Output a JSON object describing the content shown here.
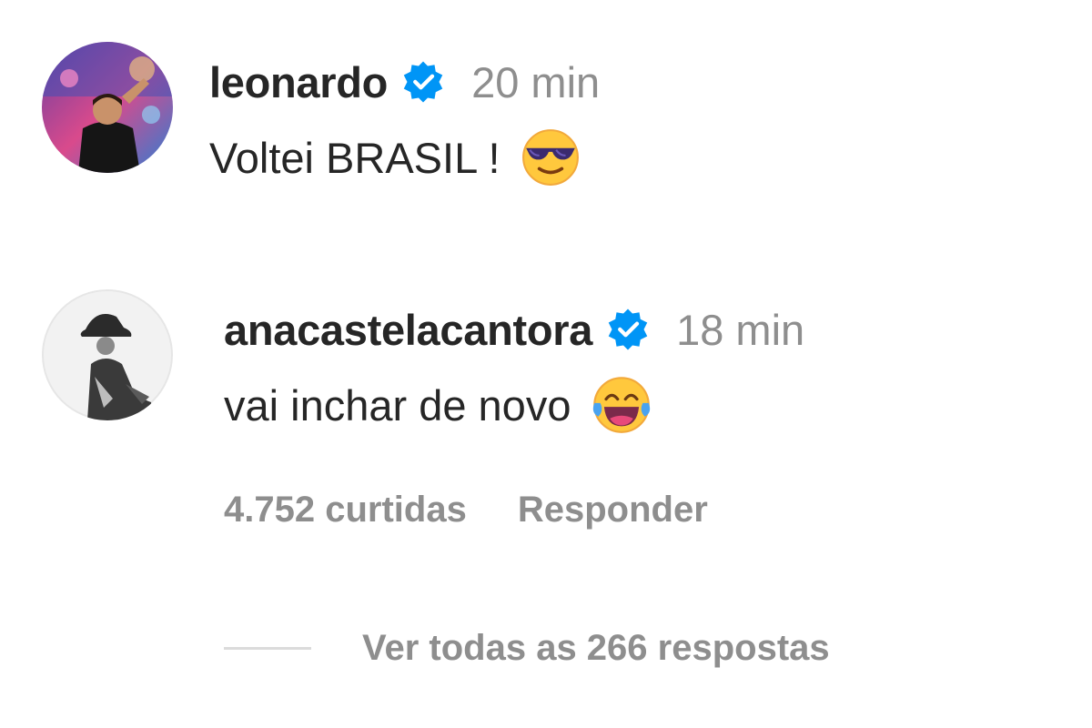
{
  "comments": [
    {
      "username": "leonardo",
      "verified": true,
      "time": "20 min",
      "text": "Voltei BRASIL !",
      "emoji": "smiling-face-with-sunglasses"
    },
    {
      "username": "anacastelacantora",
      "verified": true,
      "time": "18 min",
      "text": "vai inchar de novo",
      "emoji": "face-with-tears-of-joy",
      "likes": "4.752 curtidas",
      "reply_label": "Responder"
    }
  ],
  "view_replies": "Ver todas as 266 respostas",
  "colors": {
    "text": "#262626",
    "secondary": "#8e8e8e",
    "verified": "#0095f6"
  }
}
